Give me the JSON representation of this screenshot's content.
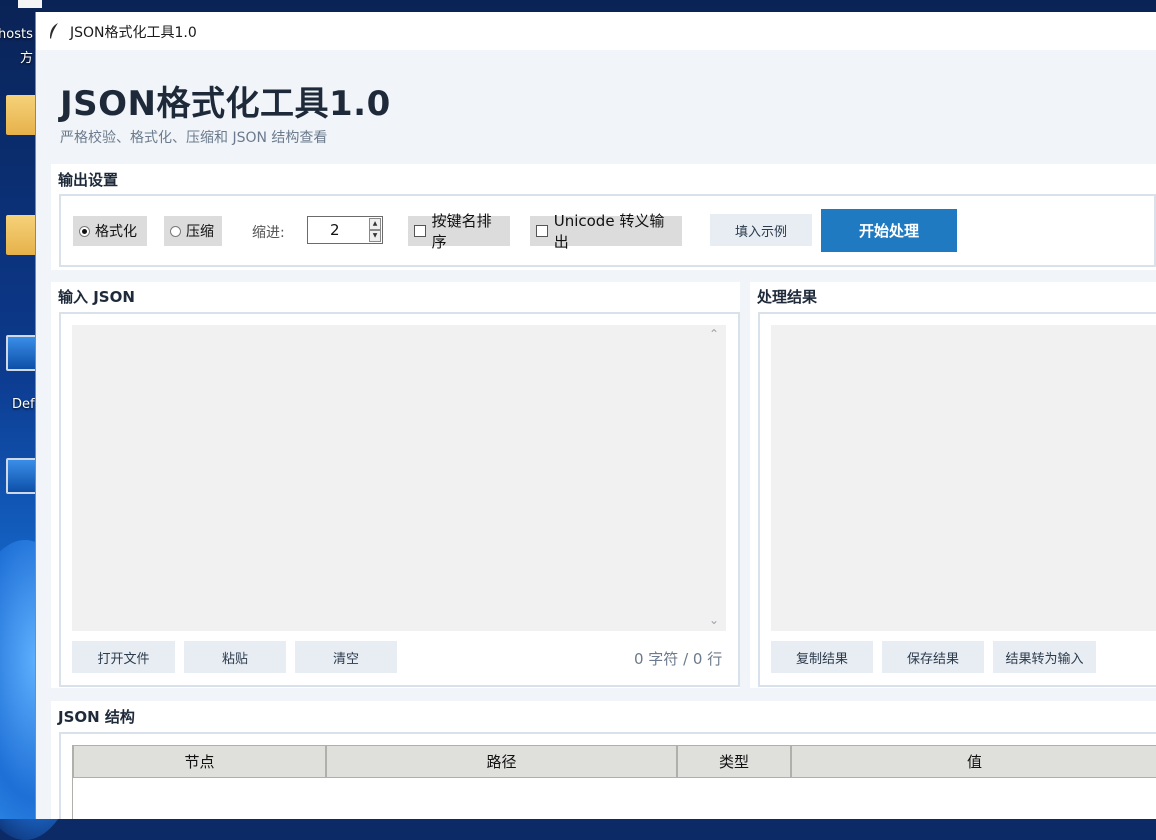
{
  "desktop": {
    "labels": [
      "hosts",
      "方",
      "Def"
    ]
  },
  "window": {
    "title": "JSON格式化工具1.0"
  },
  "header": {
    "title": "JSON格式化工具1.0",
    "subtitle": "严格校验、格式化、压缩和 JSON 结构查看"
  },
  "output_settings": {
    "label": "输出设置",
    "mode_format": "格式化",
    "mode_compress": "压缩",
    "selected_mode": "格式化",
    "indent_label": "缩进:",
    "indent_value": "2",
    "sort_keys_label": "按键名排序",
    "sort_keys_checked": false,
    "unicode_escape_label": "Unicode 转义输出",
    "unicode_escape_checked": false,
    "fill_example_label": "填入示例",
    "start_label": "开始处理"
  },
  "input_panel": {
    "label": "输入 JSON",
    "text": "",
    "open_file_label": "打开文件",
    "paste_label": "粘贴",
    "clear_label": "清空",
    "count_text": "0 字符 / 0 行"
  },
  "result_panel": {
    "label": "处理结果",
    "text": "",
    "copy_label": "复制结果",
    "save_label": "保存结果",
    "to_input_label": "结果转为输入"
  },
  "structure": {
    "label": "JSON 结构",
    "columns": [
      "节点",
      "路径",
      "类型",
      "值"
    ]
  },
  "colors": {
    "primary": "#1f7ac2",
    "window_bg": "#f1f5f9",
    "title_text": "#1e2a3a"
  }
}
